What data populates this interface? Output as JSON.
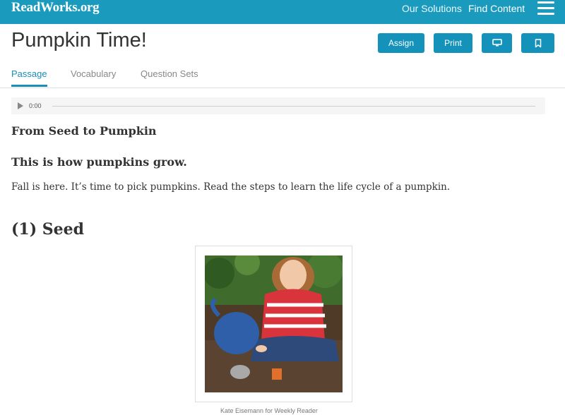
{
  "header": {
    "logo": "ReadWorks.org",
    "nav": {
      "solutions": "Our Solutions",
      "find_content": "Find Content"
    }
  },
  "page": {
    "title": "Pumpkin Time!",
    "buttons": {
      "assign": "Assign",
      "print": "Print"
    }
  },
  "tabs": [
    "Passage",
    "Vocabulary",
    "Question Sets"
  ],
  "audio": {
    "time": "0:00"
  },
  "article": {
    "heading": "From Seed to Pumpkin",
    "subheading": "This is how pumpkins grow.",
    "intro": "Fall is here. It’s time to pick pumpkins. Read the steps to learn the life cycle of a pumpkin.",
    "section_heading": "(1)  Seed",
    "figure_caption": "Kate Eisemann for Weekly Reader"
  },
  "colors": {
    "brand": "#1a9bbd",
    "button": "#1592ba",
    "active_tab": "#1a8fb5"
  },
  "icons": {
    "menu": "hamburger-icon",
    "play": "play-icon",
    "present": "monitor-icon",
    "bookmark": "bookmark-icon"
  }
}
